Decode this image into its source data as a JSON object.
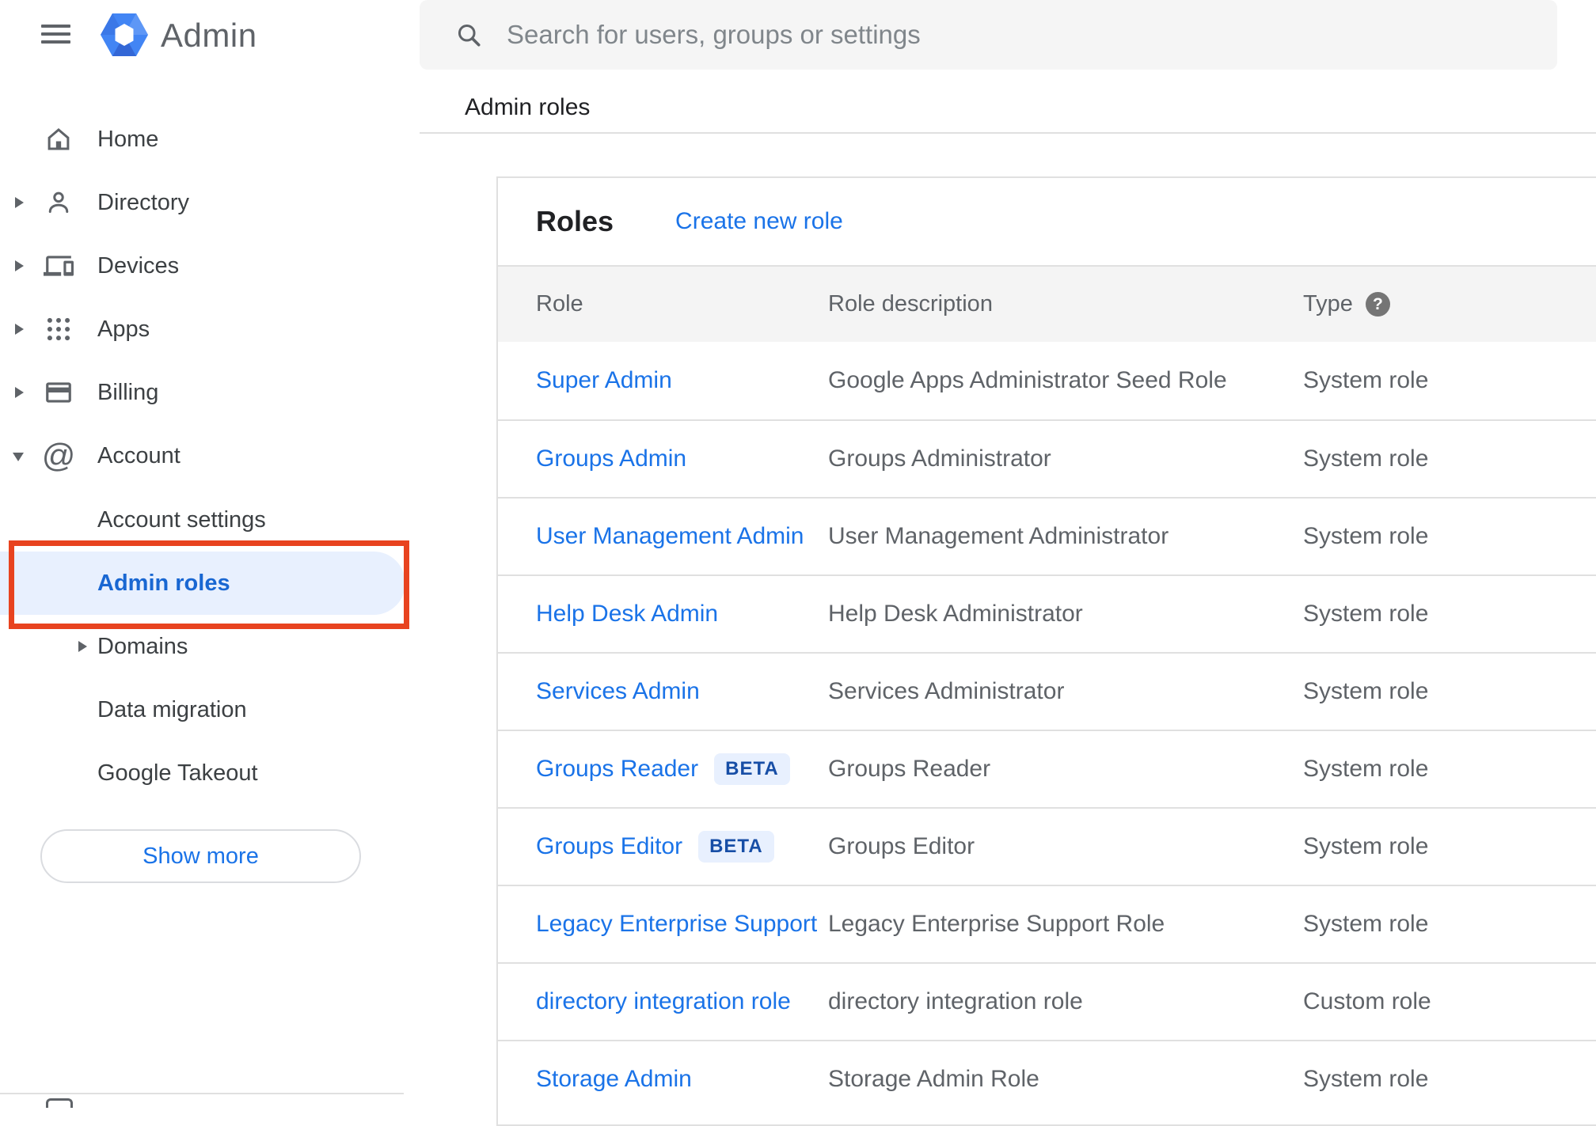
{
  "header": {
    "product_name": "Admin",
    "search_placeholder": "Search for users, groups or settings",
    "icons": [
      "hamburger-menu-icon",
      "admin-hexagon-logo",
      "search-icon"
    ]
  },
  "breadcrumb": "Admin roles",
  "sidebar": {
    "items": [
      {
        "label": "Home",
        "icon": "home-icon",
        "expandable": false
      },
      {
        "label": "Directory",
        "icon": "person-icon",
        "expandable": true
      },
      {
        "label": "Devices",
        "icon": "devices-icon",
        "expandable": true
      },
      {
        "label": "Apps",
        "icon": "apps-grid-icon",
        "expandable": true
      },
      {
        "label": "Billing",
        "icon": "credit-card-icon",
        "expandable": true
      },
      {
        "label": "Account",
        "icon": "at-sign-icon",
        "expandable": true,
        "expanded": true
      }
    ],
    "account_children": [
      {
        "label": "Account settings",
        "selected": false
      },
      {
        "label": "Admin roles",
        "selected": true,
        "annotated_with_red_box": true
      },
      {
        "label": "Domains",
        "selected": false,
        "expandable": true
      },
      {
        "label": "Data migration",
        "selected": false
      },
      {
        "label": "Google Takeout",
        "selected": false
      }
    ],
    "show_more_label": "Show more"
  },
  "panel": {
    "title": "Roles",
    "create_link": "Create new role",
    "beta_label": "BETA",
    "table": {
      "columns": [
        "Role",
        "Role description",
        "Type"
      ],
      "type_help_icon": "help-question-icon",
      "rows": [
        {
          "role": "Super Admin",
          "beta": false,
          "description": "Google Apps Administrator Seed Role",
          "type": "System role"
        },
        {
          "role": "Groups Admin",
          "beta": false,
          "description": "Groups Administrator",
          "type": "System role"
        },
        {
          "role": "User Management Admin",
          "beta": false,
          "description": "User Management Administrator",
          "type": "System role"
        },
        {
          "role": "Help Desk Admin",
          "beta": false,
          "description": "Help Desk Administrator",
          "type": "System role"
        },
        {
          "role": "Services Admin",
          "beta": false,
          "description": "Services Administrator",
          "type": "System role"
        },
        {
          "role": "Groups Reader",
          "beta": true,
          "description": "Groups Reader",
          "type": "System role"
        },
        {
          "role": "Groups Editor",
          "beta": true,
          "description": "Groups Editor",
          "type": "System role"
        },
        {
          "role": "Legacy Enterprise Support",
          "beta": false,
          "description": "Legacy Enterprise Support Role",
          "type": "System role"
        },
        {
          "role": "directory integration role",
          "beta": false,
          "description": "directory integration role",
          "type": "Custom role"
        },
        {
          "role": "Storage Admin",
          "beta": false,
          "description": "Storage Admin Role",
          "type": "System role"
        }
      ]
    }
  },
  "colors": {
    "link_blue": "#1a73e8",
    "selected_item_blue": "#1967d2",
    "selected_pill_background": "#e8f0fe",
    "annotation_red": "#e8431f",
    "beta_badge_background": "#e8f0fe",
    "beta_badge_text": "#174ea6",
    "muted_text": "#5f6368",
    "table_header_background": "#f4f4f4",
    "search_bar_background": "#f5f5f5",
    "divider": "#e0e0e0"
  }
}
